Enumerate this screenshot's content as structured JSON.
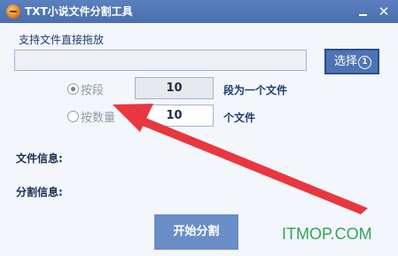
{
  "window": {
    "title": "TXT小说文件分割工具",
    "minimize_icon": "minimize-icon",
    "close_label": "✕"
  },
  "file_select": {
    "drop_label": "支持文件直接拖放",
    "path_value": "",
    "select_button_label": "选择",
    "select_button_badge": "1"
  },
  "split_options": {
    "by_paragraph": {
      "label": "按段",
      "checked": true,
      "value": "10",
      "unit_label": "段为一个文件"
    },
    "by_count": {
      "label": "按数量",
      "checked": false,
      "value": "10",
      "unit_label": "个文件"
    }
  },
  "info": {
    "file_info_label": "文件信息:",
    "split_info_label": "分割信息:"
  },
  "actions": {
    "start_label": "开始分割"
  },
  "watermark": "ITMOP.COM",
  "colors": {
    "titlebar": "#4a6fae",
    "button": "#6a8ec7",
    "arrow": "#e8373f",
    "watermark": "#2fa35a"
  }
}
